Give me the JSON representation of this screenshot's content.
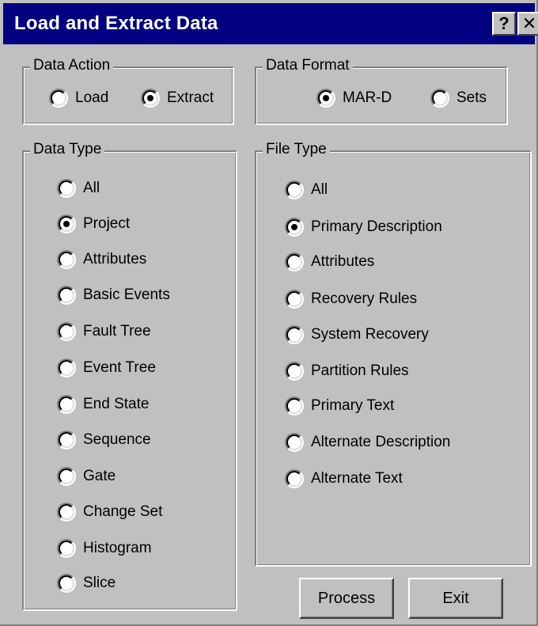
{
  "window": {
    "title": "Load and Extract Data",
    "help_label": "?",
    "close_label": "✕"
  },
  "data_action": {
    "label": "Data Action",
    "options": [
      {
        "label": "Load",
        "selected": false
      },
      {
        "label": "Extract",
        "selected": true
      }
    ]
  },
  "data_format": {
    "label": "Data Format",
    "options": [
      {
        "label": "MAR-D",
        "selected": true
      },
      {
        "label": "Sets",
        "selected": false
      }
    ]
  },
  "data_type": {
    "label": "Data Type",
    "options": [
      {
        "label": "All",
        "selected": false
      },
      {
        "label": "Project",
        "selected": true
      },
      {
        "label": "Attributes",
        "selected": false
      },
      {
        "label": "Basic Events",
        "selected": false
      },
      {
        "label": "Fault Tree",
        "selected": false
      },
      {
        "label": "Event Tree",
        "selected": false
      },
      {
        "label": "End State",
        "selected": false
      },
      {
        "label": "Sequence",
        "selected": false
      },
      {
        "label": "Gate",
        "selected": false
      },
      {
        "label": "Change Set",
        "selected": false
      },
      {
        "label": "Histogram",
        "selected": false
      },
      {
        "label": "Slice",
        "selected": false
      }
    ]
  },
  "file_type": {
    "label": "File Type",
    "options": [
      {
        "label": "All",
        "selected": false
      },
      {
        "label": "Primary Description",
        "selected": true
      },
      {
        "label": "Attributes",
        "selected": false
      },
      {
        "label": "Recovery Rules",
        "selected": false
      },
      {
        "label": "System Recovery",
        "selected": false
      },
      {
        "label": "Partition Rules",
        "selected": false
      },
      {
        "label": "Primary Text",
        "selected": false
      },
      {
        "label": "Alternate Description",
        "selected": false
      },
      {
        "label": "Alternate Text",
        "selected": false
      }
    ]
  },
  "buttons": {
    "process_label": "Process",
    "exit_label": "Exit"
  },
  "colors": {
    "face": "#c0c0c0",
    "title_bar": "#000080",
    "title_text": "#ffffff"
  }
}
